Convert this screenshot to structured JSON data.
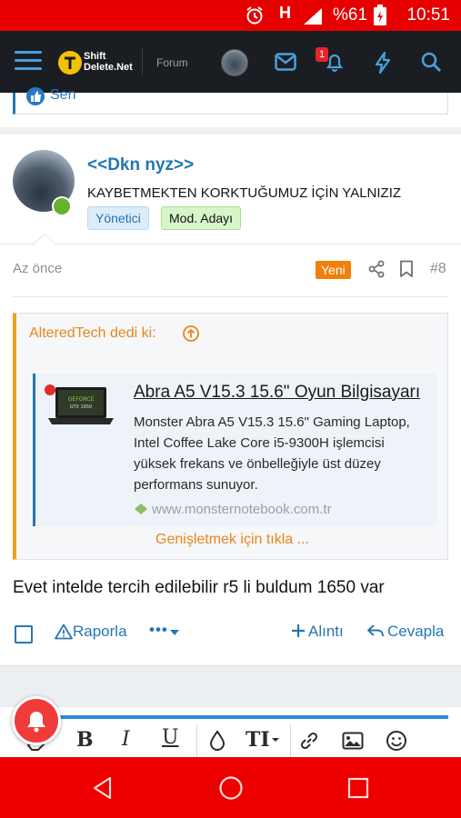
{
  "status_bar": {
    "battery_percent": "%61",
    "time": "10:51",
    "network_letter": "H"
  },
  "app_header": {
    "logo_line1": "Shift",
    "logo_line2": "Delete.Net",
    "section": "Forum",
    "alert_count": "1"
  },
  "previous_post": {
    "reaction_text": "Sen"
  },
  "post": {
    "username": "<<Dkn nyz>>",
    "user_title": "KAYBETMEKTEN KORKTUĞUMUZ İÇİN YALNIZIZ",
    "banners": [
      "Yönetici",
      "Mod. Adayı"
    ],
    "time": "Az önce",
    "new_badge": "Yeni",
    "post_number": "#8",
    "quote": {
      "author_line": "AlteredTech dedi ki:",
      "embed": {
        "title": "Abra A5 V15.3 15.6\" Oyun Bilgisayarı",
        "description": "Monster Abra A5 V15.3 15.6\" Gaming Laptop, Intel Coffee Lake Core i5-9300H işlemcisi yüksek frekans ve önbelleğiyle üst düzey performans sunuyor.",
        "url": "www.monsternotebook.com.tr"
      },
      "expand_label": "Genişletmek için tıkla ..."
    },
    "message": "Evet intelde tercih edilebilir r5 li buldum 1650 var",
    "actions": {
      "report": "Raporla",
      "more": "•••",
      "quote": "Alıntı",
      "reply": "Cevapla"
    }
  },
  "colors": {
    "status_bar": "#e60000",
    "header_bg": "#1a1e22",
    "link_blue": "#2577b1",
    "accent_orange": "#f0800a",
    "nav_bar": "#ee0000"
  }
}
